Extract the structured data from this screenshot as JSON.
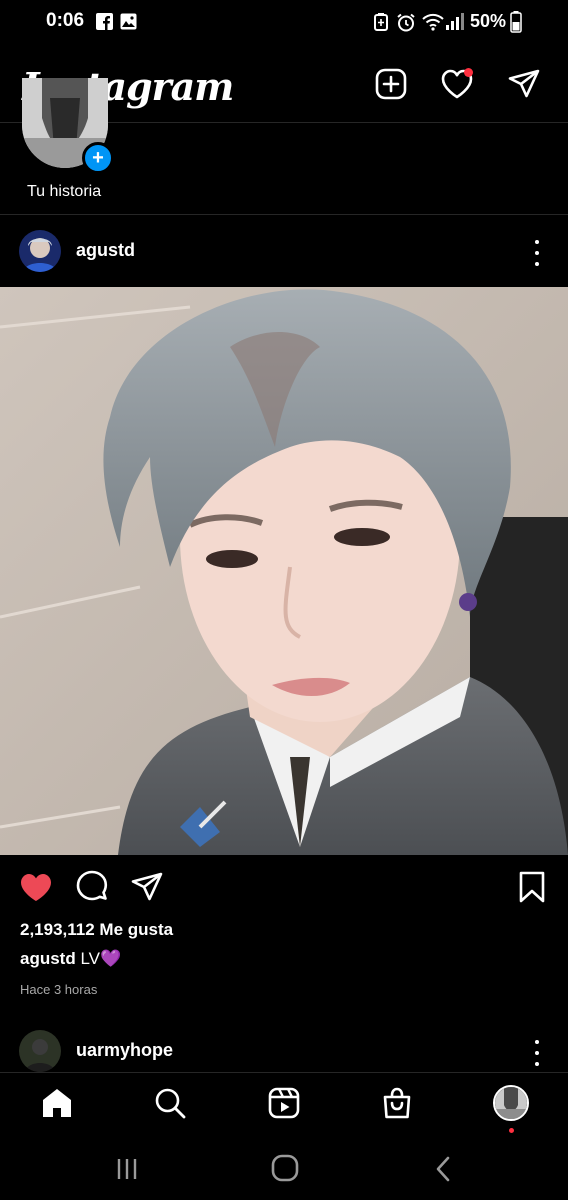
{
  "status_bar": {
    "time": "0:06",
    "battery_percent": "50%",
    "icons": [
      "facebook-icon",
      "gallery-icon",
      "alarm-icon",
      "wifi-icon",
      "signal-icon",
      "battery-icon"
    ]
  },
  "header": {
    "logo_text": "Instagram",
    "actions": [
      "new-post-icon",
      "activity-heart-icon",
      "direct-message-icon"
    ],
    "notification_color": "#ff3040"
  },
  "story": {
    "label": "Tu historia",
    "add_color": "#0095f6"
  },
  "post": {
    "username": "agustd",
    "likes": "2,193,112 Me gusta",
    "caption_user": "agustd",
    "caption_text": "LV💜",
    "time_ago": "Hace 3 horas",
    "liked": true,
    "like_color": "#ed4956"
  },
  "next_post": {
    "username": "uarmyhope"
  },
  "bottom_nav": [
    "home-icon",
    "search-icon",
    "reels-icon",
    "shop-icon",
    "profile-avatar"
  ],
  "system_nav": [
    "recents-icon",
    "home-circle-icon",
    "back-icon"
  ]
}
